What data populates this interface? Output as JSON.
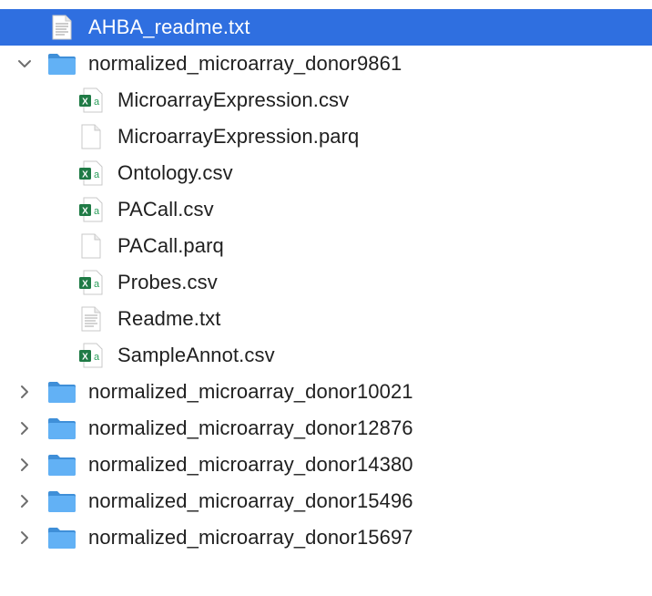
{
  "tree": {
    "readme": {
      "name": "AHBA_readme.txt",
      "icon": "text-document-icon"
    },
    "expanded_folder": {
      "name": "normalized_microarray_donor9861",
      "icon": "folder-icon",
      "expanded": true,
      "children": [
        {
          "name": "MicroarrayExpression.csv",
          "icon": "excel-csv-icon"
        },
        {
          "name": "MicroarrayExpression.parq",
          "icon": "blank-document-icon"
        },
        {
          "name": "Ontology.csv",
          "icon": "excel-csv-icon"
        },
        {
          "name": "PACall.csv",
          "icon": "excel-csv-icon"
        },
        {
          "name": "PACall.parq",
          "icon": "blank-document-icon"
        },
        {
          "name": "Probes.csv",
          "icon": "excel-csv-icon"
        },
        {
          "name": "Readme.txt",
          "icon": "text-document-icon"
        },
        {
          "name": "SampleAnnot.csv",
          "icon": "excel-csv-icon"
        }
      ]
    },
    "collapsed_folders": [
      {
        "name": "normalized_microarray_donor10021",
        "icon": "folder-icon",
        "expanded": false
      },
      {
        "name": "normalized_microarray_donor12876",
        "icon": "folder-icon",
        "expanded": false
      },
      {
        "name": "normalized_microarray_donor14380",
        "icon": "folder-icon",
        "expanded": false
      },
      {
        "name": "normalized_microarray_donor15496",
        "icon": "folder-icon",
        "expanded": false
      },
      {
        "name": "normalized_microarray_donor15697",
        "icon": "folder-icon",
        "expanded": false
      }
    ]
  },
  "colors": {
    "selection": "#2f6fe0",
    "folder": "#5aaaf0",
    "excel_green": "#1f7a45",
    "chevron": "#6e6e6e"
  }
}
